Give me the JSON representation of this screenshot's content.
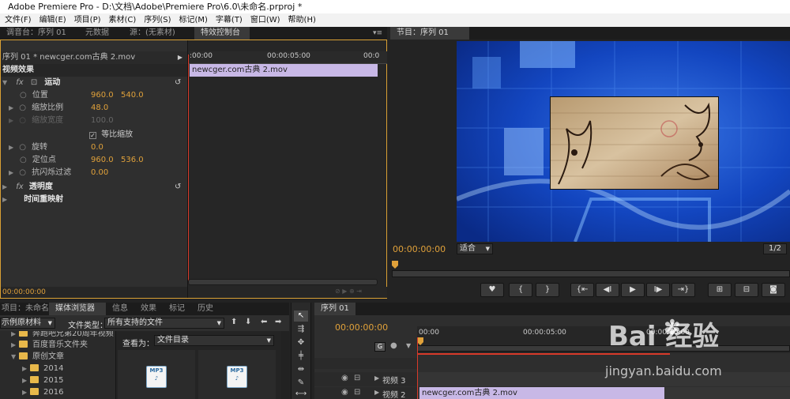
{
  "window": {
    "title": "Adobe Premiere Pro - D:\\文档\\Adobe\\Premiere Pro\\6.0\\未命名.prproj *"
  },
  "menu": [
    "文件(F)",
    "编辑(E)",
    "项目(P)",
    "素材(C)",
    "序列(S)",
    "标记(M)",
    "字幕(T)",
    "窗口(W)",
    "帮助(H)"
  ],
  "top_left_tabs": {
    "mixer": "调音台：序列 01",
    "metadata": "元数据",
    "source": "源：(无素材)",
    "effect_controls": "特效控制台"
  },
  "effect_controls": {
    "sequence_label": "序列 01 * newcger.com古典 2.mov",
    "ruler_start": ":00:00",
    "ruler_mid": "00:00:05:00",
    "ruler_end": "00:0",
    "clip_name": "newcger.com古典 2.mov",
    "section_video": "视频效果",
    "motion": "运动",
    "position_label": "位置",
    "position_x": "960.0",
    "position_y": "540.0",
    "scale_label": "缩放比例",
    "scale_value": "48.0",
    "scale_width_label": "缩放宽度",
    "scale_width_value": "100.0",
    "uniform_scale": "等比缩放",
    "rotation_label": "旋转",
    "rotation_value": "0.0",
    "anchor_label": "定位点",
    "anchor_x": "960.0",
    "anchor_y": "536.0",
    "flicker_label": "抗闪烁过滤",
    "flicker_value": "0.00",
    "opacity": "透明度",
    "time_remap": "时间重映射",
    "timecode": "00:00:00:00"
  },
  "program": {
    "tab": "节目：序列 01",
    "timecode": "00:00:00:00",
    "fit": "适合",
    "ratio": "1/2"
  },
  "bottom_left_tabs": {
    "project": "项目：未命名",
    "media_browser": "媒体浏览器",
    "info": "信息",
    "effects": "效果",
    "markers": "标记",
    "history": "历史"
  },
  "media_browser": {
    "location": "示例原材料",
    "file_type_label": "文件类型：",
    "file_type_value": "所有支持的文件",
    "view_as_label": "查看为：",
    "view_as_value": "文件目录",
    "folders": [
      "奔跑吧兄弟20周年视频",
      "百度音乐文件夹",
      "原创文章",
      "2014",
      "2015",
      "2016"
    ]
  },
  "timeline": {
    "tab": "序列 01",
    "timecode": "00:00:00:00",
    "ruler_start": "00:00",
    "ruler_mid": "00:00:05:00",
    "ruler_end": "00:00:10:00",
    "track3": "视频 3",
    "track2": "视频 2",
    "clip": "newcger.com古典 2.mov"
  },
  "watermark": {
    "brand": "Bai  经验",
    "url": "jingyan.baidu.com"
  },
  "colors": {
    "accent": "#e0a13a",
    "clip_lilac": "#c8b8e6",
    "playhead": "#d83a2a"
  }
}
